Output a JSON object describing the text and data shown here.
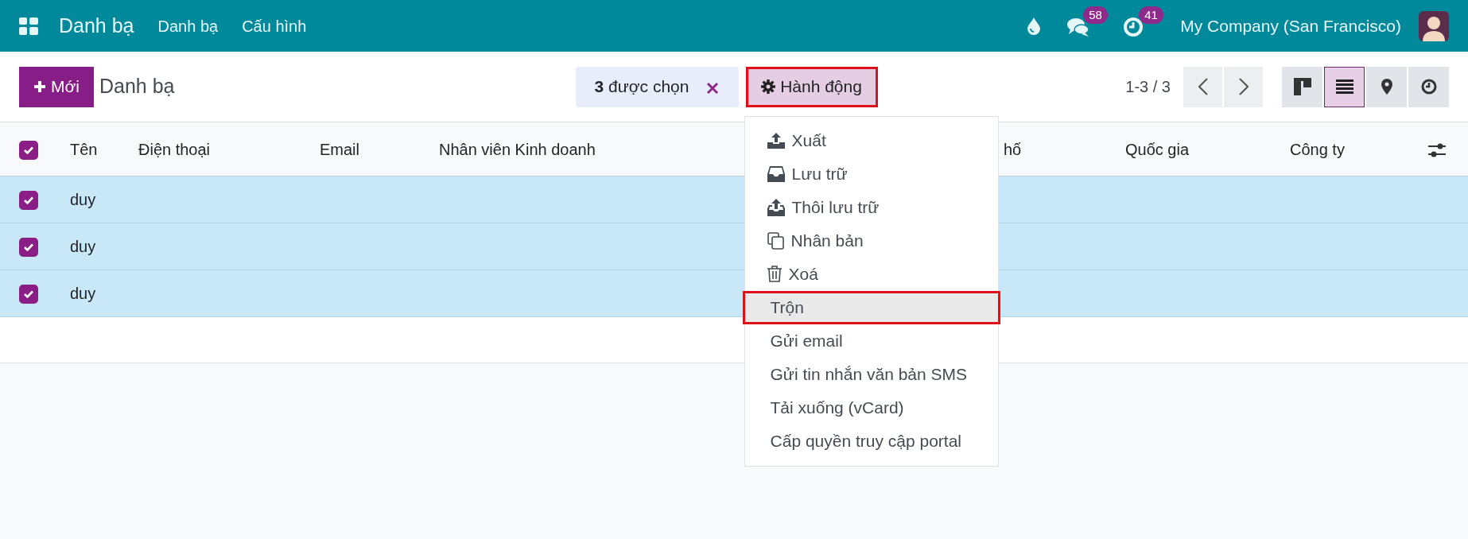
{
  "navbar": {
    "app_title": "Danh bạ",
    "menu": [
      "Danh bạ",
      "Cấu hình"
    ],
    "chat_badge": "58",
    "activity_badge": "41",
    "company": "My Company (San Francisco)"
  },
  "control_panel": {
    "new_button": "Mới",
    "title": "Danh bạ",
    "selection": {
      "count": "3",
      "label": "được chọn"
    },
    "action_button": {
      "label": "Hành động",
      "highlighted": true
    },
    "pager": "1-3 / 3",
    "views": [
      {
        "kind": "kanban",
        "selected": false
      },
      {
        "kind": "list",
        "selected": true
      },
      {
        "kind": "map",
        "selected": false
      },
      {
        "kind": "activity",
        "selected": false
      }
    ]
  },
  "action_menu": [
    {
      "kind": "export",
      "label": "Xuất",
      "highlighted": false
    },
    {
      "kind": "archive",
      "label": "Lưu trữ",
      "highlighted": false
    },
    {
      "kind": "unarchive",
      "label": "Thôi lưu trữ",
      "highlighted": false
    },
    {
      "kind": "duplicate",
      "label": "Nhân bản",
      "highlighted": false
    },
    {
      "kind": "delete",
      "label": "Xoá",
      "highlighted": false
    },
    {
      "kind": "plain",
      "label": "Trộn",
      "highlighted": true
    },
    {
      "kind": "plain",
      "label": "Gửi email",
      "highlighted": false
    },
    {
      "kind": "plain",
      "label": "Gửi tin nhắn văn bản SMS",
      "highlighted": false
    },
    {
      "kind": "plain",
      "label": "Tải xuống (vCard)",
      "highlighted": false
    },
    {
      "kind": "plain",
      "label": "Cấp quyền truy cập portal",
      "highlighted": false
    }
  ],
  "table": {
    "all_checked": true,
    "columns": [
      "Tên",
      "Điện thoại",
      "Email",
      "Nhân viên Kinh doanh",
      "hố",
      "Quốc gia",
      "Công ty"
    ],
    "rows": [
      {
        "checked": true,
        "cells": [
          "duy"
        ]
      },
      {
        "checked": true,
        "cells": [
          "duy"
        ]
      },
      {
        "checked": true,
        "cells": [
          "duy"
        ]
      }
    ]
  }
}
